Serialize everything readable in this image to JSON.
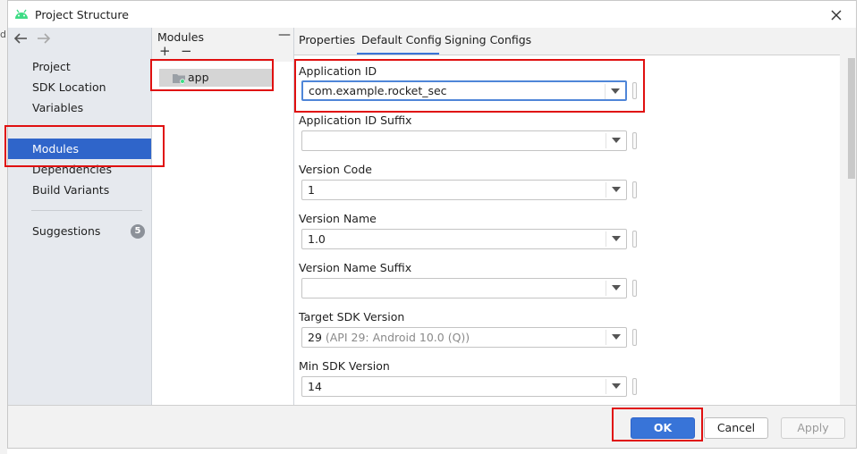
{
  "window": {
    "title": "Project Structure",
    "side_char": "d"
  },
  "sidebar": {
    "items": [
      {
        "label": "Project"
      },
      {
        "label": "SDK Location"
      },
      {
        "label": "Variables"
      },
      {
        "label": "Modules"
      },
      {
        "label": "Dependencies"
      },
      {
        "label": "Build Variants"
      },
      {
        "label": "Suggestions",
        "badge": "5"
      }
    ],
    "selected": "Modules"
  },
  "modules": {
    "header": "Modules",
    "add_label": "+",
    "remove_label": "−",
    "collapse_label": "—",
    "items": [
      {
        "name": "app"
      }
    ]
  },
  "tabs": [
    {
      "label": "Properties"
    },
    {
      "label": "Default Config"
    },
    {
      "label": "Signing Configs"
    }
  ],
  "active_tab": "Default Config",
  "form": {
    "application_id": {
      "label": "Application ID",
      "value": "com.example.rocket_sec"
    },
    "application_id_suffix": {
      "label": "Application ID Suffix",
      "value": ""
    },
    "version_code": {
      "label": "Version Code",
      "value": "1"
    },
    "version_name": {
      "label": "Version Name",
      "value": "1.0"
    },
    "version_name_suffix": {
      "label": "Version Name Suffix",
      "value": ""
    },
    "target_sdk": {
      "label": "Target SDK Version",
      "value": "29",
      "hint": " (API 29: Android 10.0 (Q))"
    },
    "min_sdk": {
      "label": "Min SDK Version",
      "value": "14"
    }
  },
  "footer": {
    "ok_label": "OK",
    "cancel_label": "Cancel",
    "apply_label": "Apply"
  },
  "colors": {
    "selection": "#2f65ca",
    "ok_button": "#3874d8",
    "highlight": "#e01010"
  }
}
